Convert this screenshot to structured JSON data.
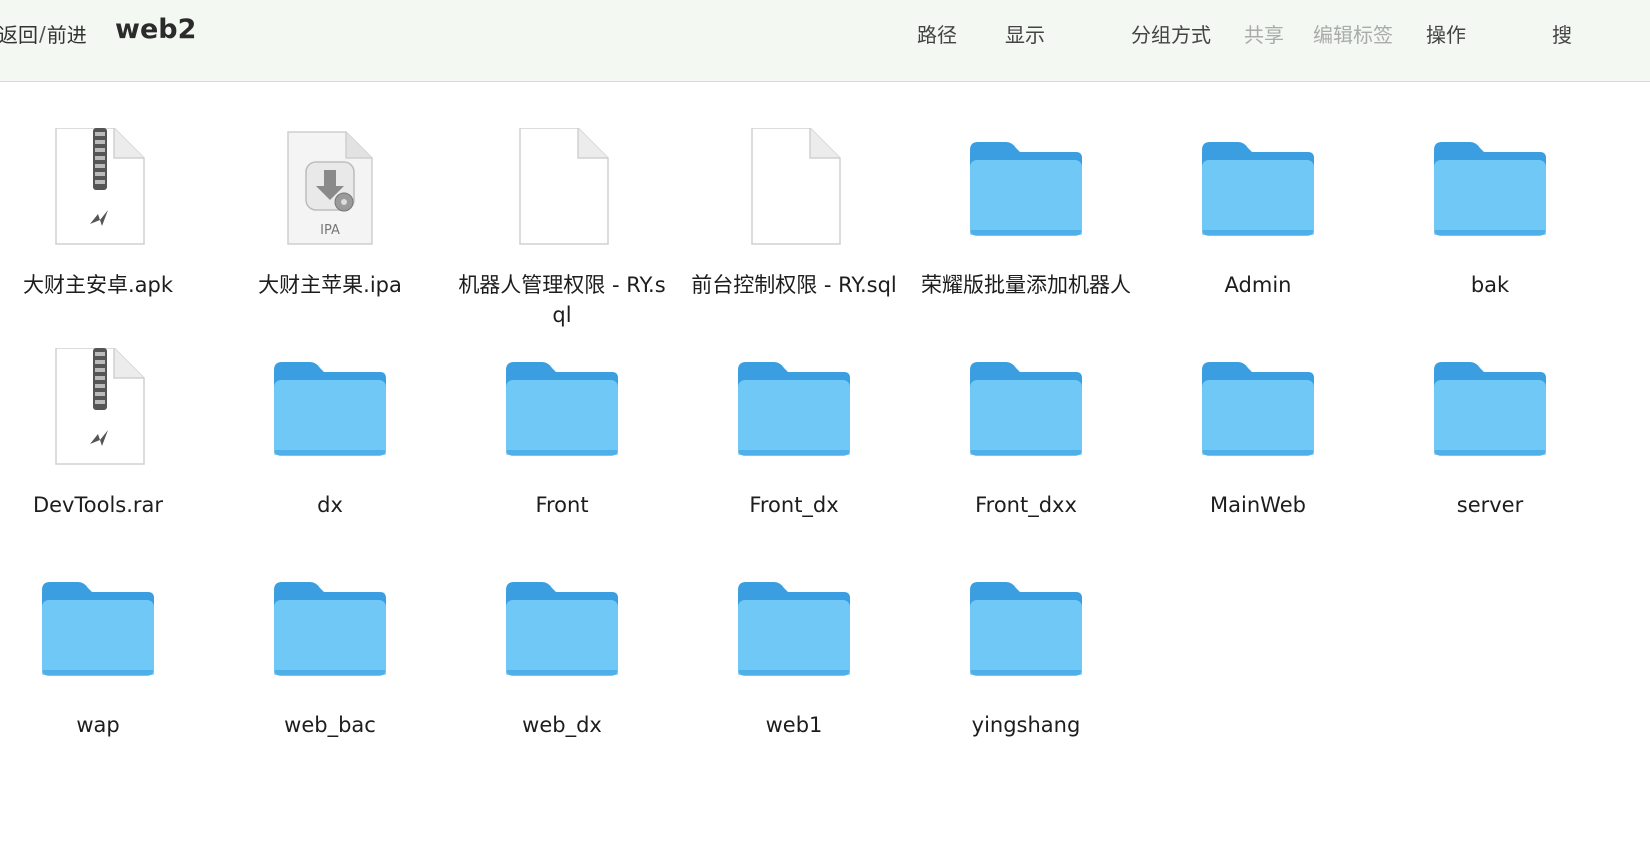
{
  "toolbar": {
    "back_label": "返回",
    "separator": "/",
    "forward_label": "前进",
    "title": "web2",
    "buttons": [
      {
        "label": "路径",
        "enabled": true
      },
      {
        "label": "显示",
        "enabled": true
      },
      {
        "label": "分组方式",
        "enabled": true
      },
      {
        "label": "共享",
        "enabled": false
      },
      {
        "label": "编辑标签",
        "enabled": false
      },
      {
        "label": "操作",
        "enabled": true
      },
      {
        "label": "搜",
        "enabled": true
      }
    ]
  },
  "items": [
    {
      "name": "大财主安卓.apk",
      "kind": "archive-file"
    },
    {
      "name": "大财主苹果.ipa",
      "kind": "ipa-file",
      "badge": "IPA"
    },
    {
      "name": "机器人管理权限 - RY.sql",
      "kind": "document-file"
    },
    {
      "name": "前台控制权限 - RY.sql",
      "kind": "document-file"
    },
    {
      "name": "荣耀版批量添加机器人",
      "kind": "folder"
    },
    {
      "name": "Admin",
      "kind": "folder"
    },
    {
      "name": "bak",
      "kind": "folder"
    },
    {
      "name": "DevTools.rar",
      "kind": "archive-file"
    },
    {
      "name": "dx",
      "kind": "folder"
    },
    {
      "name": "Front",
      "kind": "folder"
    },
    {
      "name": "Front_dx",
      "kind": "folder"
    },
    {
      "name": "Front_dxx",
      "kind": "folder"
    },
    {
      "name": "MainWeb",
      "kind": "folder"
    },
    {
      "name": "server",
      "kind": "folder"
    },
    {
      "name": "wap",
      "kind": "folder"
    },
    {
      "name": "web_bac",
      "kind": "folder"
    },
    {
      "name": "web_dx",
      "kind": "folder"
    },
    {
      "name": "web1",
      "kind": "folder"
    },
    {
      "name": "yingshang",
      "kind": "folder"
    }
  ],
  "colors": {
    "folder_front": "#6fc8f5",
    "folder_back": "#3a9ee0",
    "toolbar_bg": "#f3f8f2"
  }
}
